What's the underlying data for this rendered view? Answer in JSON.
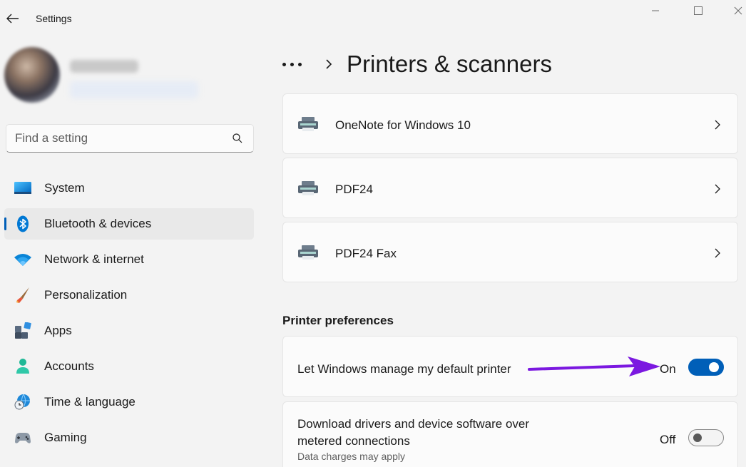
{
  "app": {
    "title": "Settings"
  },
  "search": {
    "placeholder": "Find a setting"
  },
  "nav": {
    "items": [
      {
        "label": "System",
        "icon": "monitor-icon"
      },
      {
        "label": "Bluetooth & devices",
        "icon": "bluetooth-icon",
        "selected": true
      },
      {
        "label": "Network & internet",
        "icon": "wifi-icon"
      },
      {
        "label": "Personalization",
        "icon": "brush-icon"
      },
      {
        "label": "Apps",
        "icon": "apps-icon"
      },
      {
        "label": "Accounts",
        "icon": "person-icon"
      },
      {
        "label": "Time & language",
        "icon": "globe-clock-icon"
      },
      {
        "label": "Gaming",
        "icon": "gamepad-icon"
      }
    ]
  },
  "main": {
    "title": "Printers & scanners",
    "printers": [
      {
        "name": "OneNote for Windows 10"
      },
      {
        "name": "PDF24"
      },
      {
        "name": "PDF24 Fax"
      }
    ],
    "preferences": {
      "title": "Printer preferences",
      "default_printer": {
        "label": "Let Windows manage my default printer",
        "state": "On",
        "on": true
      },
      "metered": {
        "label_line1": "Download drivers and device software over",
        "label_line2": "metered connections",
        "sub": "Data charges may apply",
        "state": "Off",
        "on": false
      }
    }
  },
  "colors": {
    "accent": "#005fb8",
    "annotation_arrow": "#7b18e0",
    "background": "#f3f3f3"
  }
}
